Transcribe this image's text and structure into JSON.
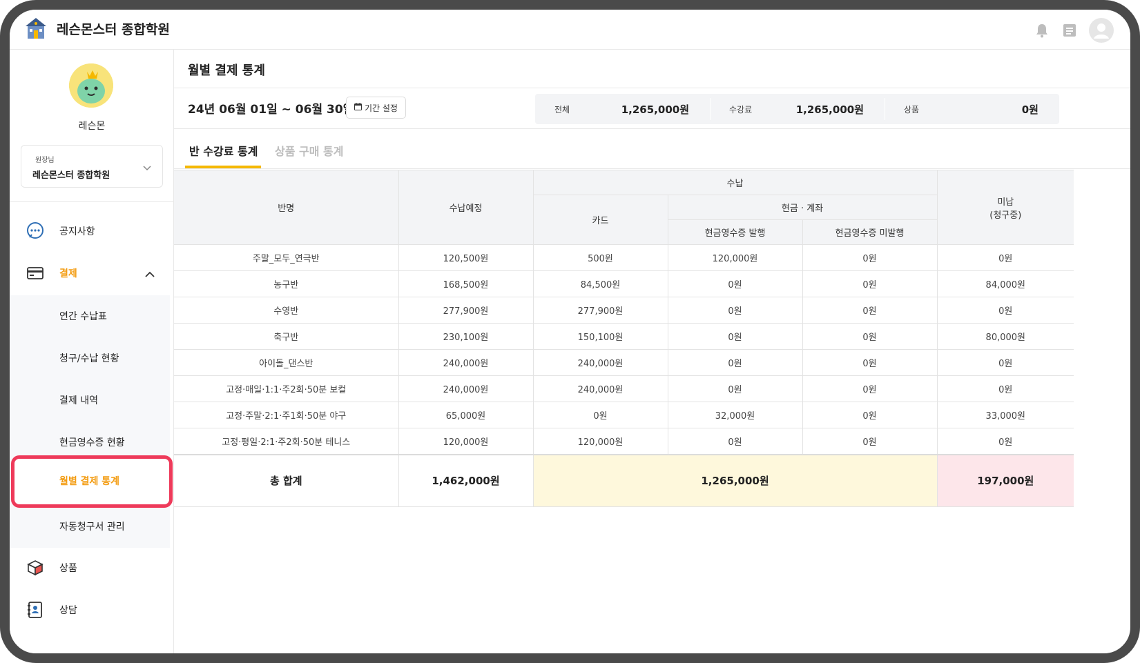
{
  "header": {
    "brand": "레슨몬스터 종합학원",
    "icons": [
      "bell-icon",
      "document-icon",
      "profile-icon"
    ]
  },
  "sidebar": {
    "user_name": "레슨몬",
    "academy_role": "원장님",
    "academy_name": "레슨몬스터 종합학원",
    "menu": {
      "notice": "공지사항",
      "payment": "결제",
      "product": "상품",
      "consult": "상담"
    },
    "payment_sub": [
      "연간 수납표",
      "청구/수납 현황",
      "결제 내역",
      "현금영수증 현황",
      "월별 결제 통계",
      "자동청구서 관리"
    ]
  },
  "main": {
    "title": "월별 결제 통계",
    "range": "24년 06월 01일 ~ 06월 30일",
    "period_button": "기간 설정",
    "summary": [
      {
        "label": "전체",
        "value": "1,265,000원"
      },
      {
        "label": "수강료",
        "value": "1,265,000원"
      },
      {
        "label": "상품",
        "value": "0원"
      }
    ],
    "tabs": [
      "반 수강료 통계",
      "상품 구매 통계"
    ]
  },
  "table": {
    "headers": {
      "class": "반명",
      "expected": "수납예정",
      "paid": "수납",
      "card": "카드",
      "cash_account": "현금 · 계좌",
      "receipt_issued": "현금영수증 발행",
      "receipt_not_issued": "현금영수증 미발행",
      "unpaid_line1": "미납",
      "unpaid_line2": "(청구중)"
    },
    "rows": [
      [
        "주말_모두_연극반",
        "120,500원",
        "500원",
        "120,000원",
        "0원",
        "0원"
      ],
      [
        "농구반",
        "168,500원",
        "84,500원",
        "0원",
        "0원",
        "84,000원"
      ],
      [
        "수영반",
        "277,900원",
        "277,900원",
        "0원",
        "0원",
        "0원"
      ],
      [
        "축구반",
        "230,100원",
        "150,100원",
        "0원",
        "0원",
        "80,000원"
      ],
      [
        "아이돌_댄스반",
        "240,000원",
        "240,000원",
        "0원",
        "0원",
        "0원"
      ],
      [
        "고정·매일·1:1·주2회·50분 보컬",
        "240,000원",
        "240,000원",
        "0원",
        "0원",
        "0원"
      ],
      [
        "고정·주말·2:1·주1회·50분 야구",
        "65,000원",
        "0원",
        "32,000원",
        "0원",
        "33,000원"
      ],
      [
        "고정·평일·2:1·주2회·50분 테니스",
        "120,000원",
        "120,000원",
        "0원",
        "0원",
        "0원"
      ]
    ],
    "total": {
      "label": "총 합계",
      "expected": "1,462,000원",
      "paid": "1,265,000원",
      "unpaid": "197,000원"
    }
  },
  "colors": {
    "accent": "#f39c12",
    "tab_underline": "#f5b800",
    "highlight_border": "#ee3a5a",
    "paid_total_bg": "#fef8dc",
    "unpaid_total_bg": "#fde6ea"
  }
}
